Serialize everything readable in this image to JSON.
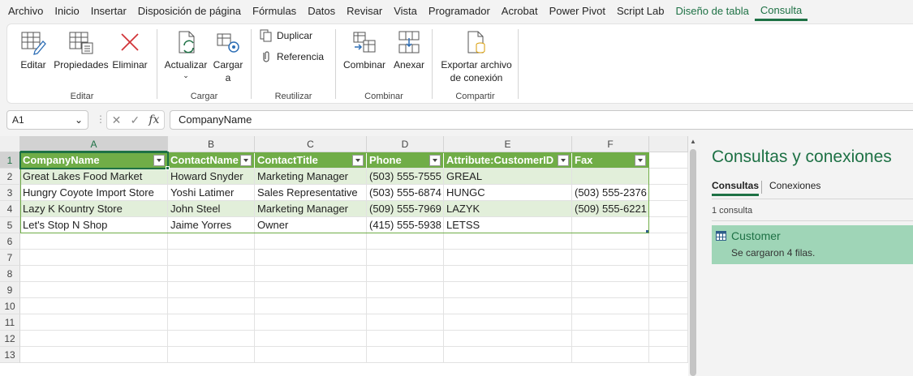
{
  "tabs": [
    "Archivo",
    "Inicio",
    "Insertar",
    "Disposición de página",
    "Fórmulas",
    "Datos",
    "Revisar",
    "Vista",
    "Programador",
    "Acrobat",
    "Power Pivot",
    "Script Lab",
    "Diseño de tabla",
    "Consulta"
  ],
  "active_tab": "Consulta",
  "ribbon": {
    "groups": {
      "editar": {
        "label": "Editar",
        "buttons": [
          "Editar",
          "Propiedades",
          "Eliminar"
        ]
      },
      "cargar": {
        "label": "Cargar",
        "actualizar": "Actualizar",
        "cargar_a_1": "Cargar",
        "cargar_a_2": "a"
      },
      "reutilizar": {
        "label": "Reutilizar",
        "duplicar": "Duplicar",
        "referencia": "Referencia"
      },
      "combinar": {
        "label": "Combinar",
        "combinar": "Combinar",
        "anexar": "Anexar"
      },
      "compartir": {
        "label": "Compartir",
        "exportar_1": "Exportar archivo",
        "exportar_2": "de conexión"
      }
    }
  },
  "formula_bar": {
    "name_box": "A1",
    "fx": "fx",
    "value": "CompanyName"
  },
  "sheet": {
    "columns": [
      "A",
      "B",
      "C",
      "D",
      "E",
      "F"
    ],
    "rows": [
      "1",
      "2",
      "3",
      "4",
      "5",
      "6",
      "7",
      "8",
      "9",
      "10",
      "11",
      "12",
      "13"
    ],
    "headers": [
      "CompanyName",
      "ContactName",
      "ContactTitle",
      "Phone",
      "Attribute:CustomerID",
      "Fax"
    ],
    "data": [
      [
        "Great Lakes Food Market",
        "Howard Snyder",
        "Marketing Manager",
        "(503) 555-7555",
        "GREAL",
        ""
      ],
      [
        "Hungry Coyote Import Store",
        "Yoshi Latimer",
        "Sales Representative",
        "(503) 555-6874",
        "HUNGC",
        "(503) 555-2376"
      ],
      [
        "Lazy K Kountry Store",
        "John Steel",
        "Marketing Manager",
        "(509) 555-7969",
        "LAZYK",
        "(509) 555-6221"
      ],
      [
        "Let's Stop N Shop",
        "Jaime Yorres",
        "Owner",
        "(415) 555-5938",
        "LETSS",
        ""
      ]
    ]
  },
  "pane": {
    "title": "Consultas y conexiones",
    "tabs": [
      "Consultas",
      "Conexiones"
    ],
    "count": "1 consulta",
    "query": {
      "name": "Customer",
      "status": "Se cargaron 4 filas."
    }
  },
  "colors": {
    "accent": "#1e7145",
    "table_header": "#70ad47",
    "band": "#e2efda",
    "query_selected": "#9fd5b7"
  }
}
